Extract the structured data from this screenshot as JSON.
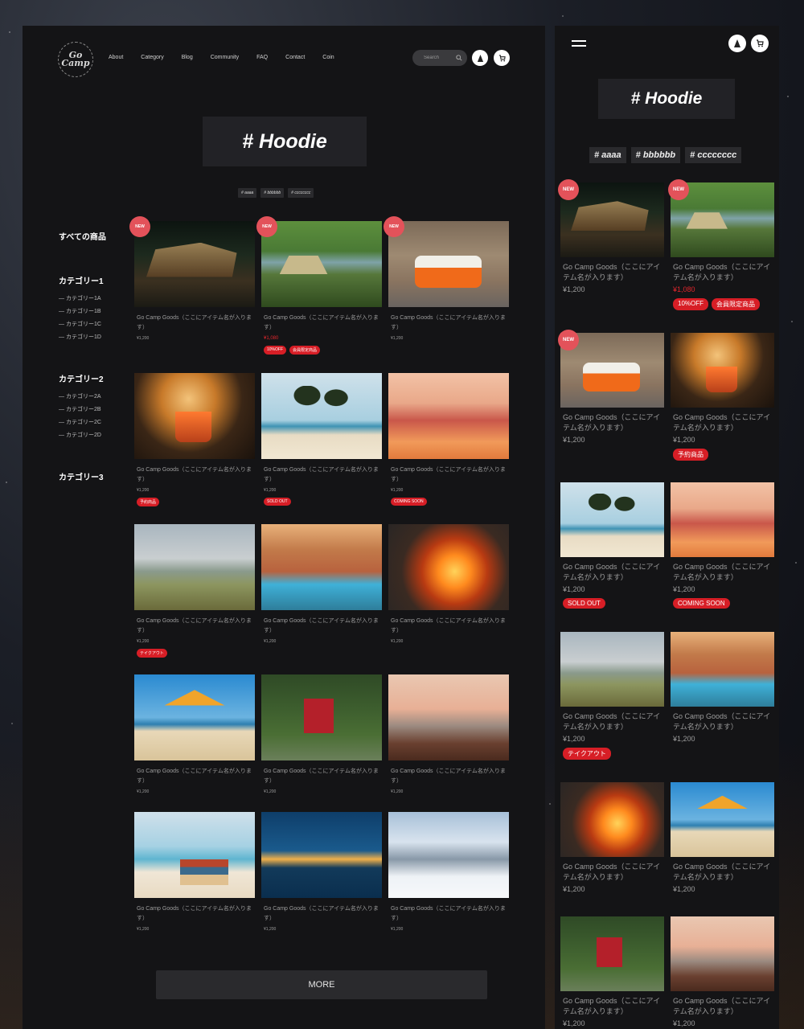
{
  "desktop": {
    "logo": "Go Camp",
    "nav": [
      "About",
      "Category",
      "Blog",
      "Community",
      "FAQ",
      "Contact",
      "Coin"
    ],
    "search_placeholder": "Search",
    "hero": "# Hoodie",
    "tags": [
      "# aaaa",
      "# bbbbbb",
      "# cccccccc"
    ],
    "sidebar": [
      {
        "title": "すべての商品",
        "subs": []
      },
      {
        "title": "カテゴリー1",
        "subs": [
          "カテゴリー1A",
          "カテゴリー1B",
          "カテゴリー1C",
          "カテゴリー1D"
        ]
      },
      {
        "title": "カテゴリー2",
        "subs": [
          "カテゴリー2A",
          "カテゴリー2B",
          "カテゴリー2C",
          "カテゴリー2D"
        ]
      },
      {
        "title": "カテゴリー3",
        "subs": []
      }
    ],
    "products": [
      {
        "name": "Go Camp Goods（ここにアイテム名が入ります）",
        "price": "¥1,200",
        "new": "NEW",
        "badges": [],
        "scene": "night"
      },
      {
        "name": "Go Camp Goods（ここにアイテム名が入ります）",
        "price": "¥1,080",
        "price_red": true,
        "new": "NEW",
        "badges": [
          "10%OFF",
          "会員限定商品"
        ],
        "scene": "lake"
      },
      {
        "name": "Go Camp Goods（ここにアイテム名が入ります）",
        "price": "¥1,200",
        "new": "NEW",
        "badges": [],
        "scene": "van"
      },
      {
        "name": "Go Camp Goods（ここにアイテム名が入ります）",
        "price": "¥1,200",
        "badges": [
          "予約商品"
        ],
        "scene": "cup"
      },
      {
        "name": "Go Camp Goods（ここにアイテム名が入ります）",
        "price": "¥1,200",
        "badges": [
          "SOLD OUT"
        ],
        "scene": "palms"
      },
      {
        "name": "Go Camp Goods（ここにアイテム名が入ります）",
        "price": "¥1,200",
        "badges": [
          "COMING SOON"
        ],
        "scene": "sunset"
      },
      {
        "name": "Go Camp Goods（ここにアイテム名が入ります）",
        "price": "¥1,200",
        "badges": [
          "テイクアウト"
        ],
        "scene": "swing"
      },
      {
        "name": "Go Camp Goods（ここにアイテム名が入ります）",
        "price": "¥1,200",
        "badges": [],
        "scene": "pool"
      },
      {
        "name": "Go Camp Goods（ここにアイテム名が入ります）",
        "price": "¥1,200",
        "badges": [],
        "scene": "fire"
      },
      {
        "name": "Go Camp Goods（ここにアイテム名が入ります）",
        "price": "¥1,200",
        "badges": [],
        "scene": "umbrella"
      },
      {
        "name": "Go Camp Goods（ここにアイテム名が入ります）",
        "price": "¥1,200",
        "badges": [],
        "scene": "forest"
      },
      {
        "name": "Go Camp Goods（ここにアイテム名が入ります）",
        "price": "¥1,200",
        "badges": [],
        "scene": "deck"
      },
      {
        "name": "Go Camp Goods（ここにアイテム名が入ります）",
        "price": "¥1,200",
        "badges": [],
        "scene": "books"
      },
      {
        "name": "Go Camp Goods（ここにアイテム名が入ります）",
        "price": "¥1,200",
        "badges": [],
        "scene": "pier"
      },
      {
        "name": "Go Camp Goods（ここにアイテム名が入ります）",
        "price": "¥1,200",
        "badges": [],
        "scene": "snow"
      }
    ],
    "more_label": "MORE"
  },
  "mobile": {
    "hero": "# Hoodie",
    "tags": [
      "# aaaa",
      "# bbbbbb",
      "# cccccccc"
    ],
    "products": [
      {
        "name": "Go Camp Goods（ここにアイテム名が入ります）",
        "price": "¥1,200",
        "new": "NEW",
        "badges": [],
        "scene": "night"
      },
      {
        "name": "Go Camp Goods（ここにアイテム名が入ります）",
        "price": "¥1,080",
        "price_red": true,
        "new": "NEW",
        "badges": [
          "10%OFF",
          "会員限定商品"
        ],
        "scene": "lake"
      },
      {
        "name": "Go Camp Goods（ここにアイテム名が入ります）",
        "price": "¥1,200",
        "new": "NEW",
        "badges": [],
        "scene": "van"
      },
      {
        "name": "Go Camp Goods（ここにアイテム名が入ります）",
        "price": "¥1,200",
        "badges": [
          "予約商品"
        ],
        "scene": "cup"
      },
      {
        "name": "Go Camp Goods（ここにアイテム名が入ります）",
        "price": "¥1,200",
        "badges": [
          "SOLD OUT"
        ],
        "scene": "palms"
      },
      {
        "name": "Go Camp Goods（ここにアイテム名が入ります）",
        "price": "¥1,200",
        "badges": [
          "COMING SOON"
        ],
        "scene": "sunset"
      },
      {
        "name": "Go Camp Goods（ここにアイテム名が入ります）",
        "price": "¥1,200",
        "badges": [
          "テイクアウト"
        ],
        "scene": "swing"
      },
      {
        "name": "Go Camp Goods（ここにアイテム名が入ります）",
        "price": "¥1,200",
        "badges": [],
        "scene": "pool"
      },
      {
        "name": "Go Camp Goods（ここにアイテム名が入ります）",
        "price": "¥1,200",
        "badges": [],
        "scene": "fire"
      },
      {
        "name": "Go Camp Goods（ここにアイテム名が入ります）",
        "price": "¥1,200",
        "badges": [],
        "scene": "umbrella"
      },
      {
        "name": "Go Camp Goods（ここにアイテム名が入ります）",
        "price": "¥1,200",
        "badges": [],
        "scene": "forest"
      },
      {
        "name": "Go Camp Goods（ここにアイテム名が入ります）",
        "price": "¥1,200",
        "badges": [],
        "scene": "deck"
      }
    ]
  },
  "icons": {
    "cart": "cart-icon",
    "camp": "tent-icon",
    "search": "search-icon",
    "menu": "hamburger-icon"
  },
  "colors": {
    "badge": "#d71e26",
    "new_badge": "#e3525a",
    "panel": "#141416"
  }
}
